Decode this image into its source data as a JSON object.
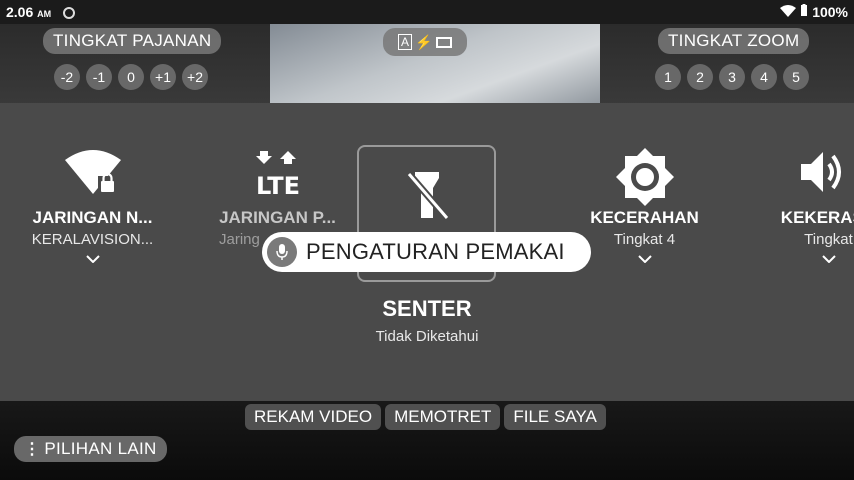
{
  "status_bar": {
    "time": "2.06",
    "ampm": "AM",
    "battery": "100%"
  },
  "camera": {
    "exposure_label": "TINGKAT PAJANAN",
    "exposure_levels": [
      "-2",
      "-1",
      "0",
      "+1",
      "+2"
    ],
    "zoom_label": "TINGKAT ZOOM",
    "zoom_levels": [
      "1",
      "2",
      "3",
      "4",
      "5"
    ],
    "modes": [
      "REKAM VIDEO",
      "MEMOTRET",
      "FILE SAYA"
    ],
    "more_options": "PILIHAN LAIN"
  },
  "quick_settings": {
    "tiles": [
      {
        "title": "JARINGAN N...",
        "subtitle": "KERALAVISION...",
        "icon": "wifi-icon"
      },
      {
        "title": "JARINGAN P...",
        "subtitle": "Jaring",
        "icon": "lte-icon"
      },
      {
        "title": "SENTER",
        "subtitle": "Tidak Diketahui",
        "icon": "flashlight-off-icon"
      },
      {
        "title": "KECERAHAN",
        "subtitle": "Tingkat 4",
        "icon": "brightness-icon"
      },
      {
        "title": "KEKERASA",
        "subtitle": "Tingkat",
        "icon": "volume-icon"
      }
    ]
  },
  "toast": {
    "label": "PENGATURAN PEMAKAI"
  }
}
